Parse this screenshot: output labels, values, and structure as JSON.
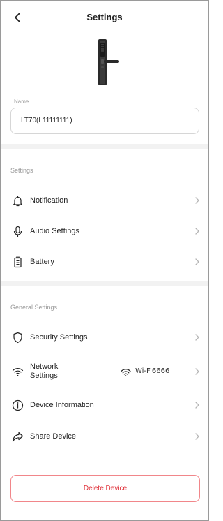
{
  "header": {
    "title": "Settings"
  },
  "device": {
    "name_label": "Name",
    "name_value": "LT70(L11111111)"
  },
  "settings_section": {
    "label": "Settings",
    "items": [
      {
        "label": "Notification",
        "icon": "bell-icon"
      },
      {
        "label": "Audio Settings",
        "icon": "microphone-icon"
      },
      {
        "label": "Battery",
        "icon": "battery-icon"
      }
    ]
  },
  "general_section": {
    "label": "General Settings",
    "items": [
      {
        "label": "Security Settings",
        "icon": "shield-icon"
      },
      {
        "label": "Network Settings",
        "icon": "wifi-icon",
        "value": "Wi-Fi6666"
      },
      {
        "label": "Device Information",
        "icon": "info-icon"
      },
      {
        "label": "Share Device",
        "icon": "share-icon"
      }
    ]
  },
  "delete_button": {
    "label": "Delete Device"
  },
  "colors": {
    "accent_red": "#e0333b",
    "delete_border": "#f1868a",
    "section_gap": "#f2f2f2",
    "muted_text": "#9a9a9a"
  }
}
